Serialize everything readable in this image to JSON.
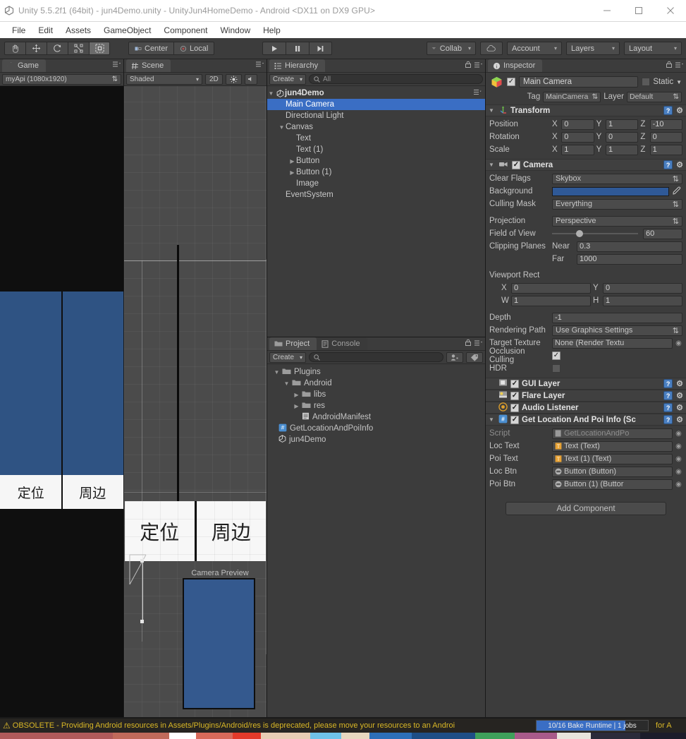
{
  "window": {
    "title": "Unity 5.5.2f1 (64bit) - jun4Demo.unity - UnityJun4HomeDemo - Android <DX11 on DX9 GPU>",
    "minimize_label": "minimize-window",
    "maximize_label": "maximize-window",
    "close_label": "close-window"
  },
  "menubar": {
    "items": [
      "File",
      "Edit",
      "Assets",
      "GameObject",
      "Component",
      "Window",
      "Help"
    ]
  },
  "toolbar": {
    "transform_tools": [
      "hand-tool",
      "move-tool",
      "rotate-tool",
      "scale-tool",
      "rect-tool"
    ],
    "active_tool": "rect-tool",
    "pivot_mode": "Center",
    "pivot_rotation": "Local",
    "play": "play-button",
    "pause": "pause-button",
    "step": "step-button",
    "collab": "Collab",
    "cloud": "cloud-button",
    "account": "Account",
    "layers": "Layers",
    "layout": "Layout"
  },
  "game_view": {
    "tab": "Game",
    "resolution": "myApi (1080x1920)",
    "buttons": [
      "定位",
      "周边"
    ],
    "background_color": "#2f5383"
  },
  "scene_view": {
    "tab": "Scene",
    "shading": "Shaded",
    "mode_2d": "2D",
    "lighting": "lighting-toggle",
    "audio": "audio-toggle",
    "canvas_texts": [
      "定位",
      "周边"
    ],
    "camera_preview_label": "Camera Preview"
  },
  "hierarchy": {
    "tab": "Hierarchy",
    "create_label": "Create",
    "search_placeholder": "All",
    "items": [
      {
        "label": "jun4Demo",
        "depth": 0,
        "icon": "unity-scene-icon",
        "expanded": true,
        "selected": false,
        "bold": true
      },
      {
        "label": "Main Camera",
        "depth": 1,
        "icon": "",
        "expanded": null,
        "selected": true,
        "bold": false
      },
      {
        "label": "Directional Light",
        "depth": 1,
        "icon": "",
        "expanded": null,
        "selected": false,
        "bold": false
      },
      {
        "label": "Canvas",
        "depth": 1,
        "icon": "",
        "expanded": true,
        "selected": false,
        "bold": false
      },
      {
        "label": "Text",
        "depth": 2,
        "icon": "",
        "expanded": null,
        "selected": false,
        "bold": false
      },
      {
        "label": "Text (1)",
        "depth": 2,
        "icon": "",
        "expanded": null,
        "selected": false,
        "bold": false
      },
      {
        "label": "Button",
        "depth": 2,
        "icon": "",
        "expanded": false,
        "selected": false,
        "bold": false
      },
      {
        "label": "Button (1)",
        "depth": 2,
        "icon": "",
        "expanded": false,
        "selected": false,
        "bold": false
      },
      {
        "label": "Image",
        "depth": 2,
        "icon": "",
        "expanded": null,
        "selected": false,
        "bold": false
      },
      {
        "label": "EventSystem",
        "depth": 1,
        "icon": "",
        "expanded": null,
        "selected": false,
        "bold": false
      }
    ]
  },
  "project": {
    "tab": "Project",
    "console_tab": "Console",
    "create_label": "Create",
    "search_placeholder": "",
    "items": [
      {
        "label": "Plugins",
        "depth": 0,
        "icon": "folder-icon",
        "expanded": true
      },
      {
        "label": "Android",
        "depth": 1,
        "icon": "folder-icon",
        "expanded": true
      },
      {
        "label": "libs",
        "depth": 2,
        "icon": "folder-icon",
        "expanded": false
      },
      {
        "label": "res",
        "depth": 2,
        "icon": "folder-icon",
        "expanded": false
      },
      {
        "label": "AndroidManifest",
        "depth": 2,
        "icon": "file-icon",
        "expanded": null
      },
      {
        "label": "GetLocationAndPoiInfo",
        "depth": 0,
        "icon": "script-icon",
        "expanded": null
      },
      {
        "label": "jun4Demo",
        "depth": 0,
        "icon": "unity-scene-icon",
        "expanded": null
      }
    ]
  },
  "inspector": {
    "tab": "Inspector",
    "object_name": "Main Camera",
    "object_enabled": true,
    "static_label": "Static",
    "static_checked": false,
    "tag_label": "Tag",
    "tag_value": "MainCamera",
    "layer_label": "Layer",
    "layer_value": "Default",
    "transform": {
      "title": "Transform",
      "rows": [
        {
          "label": "Position",
          "x": "0",
          "y": "1",
          "z": "-10"
        },
        {
          "label": "Rotation",
          "x": "0",
          "y": "0",
          "z": "0"
        },
        {
          "label": "Scale",
          "x": "1",
          "y": "1",
          "z": "1"
        }
      ],
      "axes": [
        "X",
        "Y",
        "Z"
      ]
    },
    "camera": {
      "title": "Camera",
      "enabled": true,
      "clear_flags_label": "Clear Flags",
      "clear_flags_value": "Skybox",
      "background_label": "Background",
      "background_color": "#2f5997",
      "culling_mask_label": "Culling Mask",
      "culling_mask_value": "Everything",
      "projection_label": "Projection",
      "projection_value": "Perspective",
      "fov_label": "Field of View",
      "fov_value": "60",
      "clipping_label": "Clipping Planes",
      "near_label": "Near",
      "near_value": "0.3",
      "far_label": "Far",
      "far_value": "1000",
      "viewport_label": "Viewport Rect",
      "viewport": {
        "x_label": "X",
        "x": "0",
        "y_label": "Y",
        "y": "0",
        "w_label": "W",
        "w": "1",
        "h_label": "H",
        "h": "1"
      },
      "depth_label": "Depth",
      "depth_value": "-1",
      "rendering_path_label": "Rendering Path",
      "rendering_path_value": "Use Graphics Settings",
      "target_texture_label": "Target Texture",
      "target_texture_value": "None (Render Textu",
      "occlusion_label": "Occlusion Culling",
      "occlusion_checked": true,
      "hdr_label": "HDR",
      "hdr_checked": false
    },
    "gui_layer": {
      "title": "GUI Layer",
      "enabled": true
    },
    "flare_layer": {
      "title": "Flare Layer",
      "enabled": true
    },
    "audio_listener": {
      "title": "Audio Listener",
      "enabled": true
    },
    "script_component": {
      "title": "Get Location And Poi Info (Sc",
      "enabled": true,
      "rows": [
        {
          "label": "Script",
          "value": "GetLocationAndPo",
          "icon": "script-icon",
          "dim": true
        },
        {
          "label": "Loc Text",
          "value": "Text (Text)",
          "icon": "text-icon",
          "dim": false
        },
        {
          "label": "Poi Text",
          "value": "Text (1) (Text)",
          "icon": "text-icon",
          "dim": false
        },
        {
          "label": "Loc Btn",
          "value": "Button (Button)",
          "icon": "button-icon",
          "dim": false
        },
        {
          "label": "Poi Btn",
          "value": "Button (1) (Buttor",
          "icon": "button-icon",
          "dim": false
        }
      ]
    },
    "add_component_label": "Add Component"
  },
  "status": {
    "warning_text": "OBSOLETE - Providing Android resources in Assets/Plugins/Android/res is deprecated, please move your resources to an Androi",
    "bake_text": "10/16 Bake Runtime | 1 jobs",
    "tail_text": "for A",
    "warning_color": "#d9b726",
    "bake_progress": 79
  }
}
